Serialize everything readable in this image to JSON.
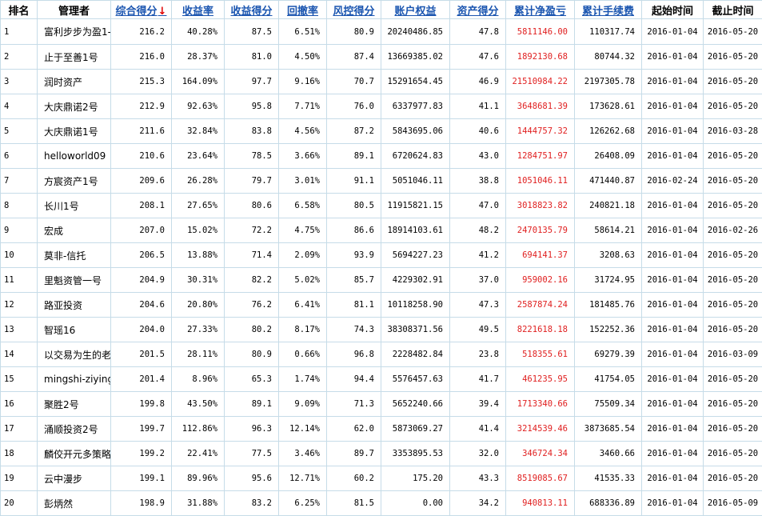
{
  "headers": [
    "排名",
    "管理者",
    "综合得分",
    "收益率",
    "收益得分",
    "回撤率",
    "风控得分",
    "账户权益",
    "资产得分",
    "累计净盈亏",
    "累计手续费",
    "起始时间",
    "截止时间"
  ],
  "sort_arrow": "↓",
  "colors": {
    "border": "#c6dce8",
    "link": "#1a55b0",
    "red": "#e02020"
  },
  "rows": [
    [
      "1",
      "富利步步为盈1-",
      "216.2",
      "40.28%",
      "87.5",
      "6.51%",
      "80.9",
      "20240486.85",
      "47.8",
      "5811146.00",
      "110317.74",
      "2016-01-04",
      "2016-05-20"
    ],
    [
      "2",
      "止于至善1号",
      "216.0",
      "28.37%",
      "81.0",
      "4.50%",
      "87.4",
      "13669385.02",
      "47.6",
      "1892130.68",
      "80744.32",
      "2016-01-04",
      "2016-05-20"
    ],
    [
      "3",
      "润时资产",
      "215.3",
      "164.09%",
      "97.7",
      "9.16%",
      "70.7",
      "15291654.45",
      "46.9",
      "21510984.22",
      "2197305.78",
      "2016-01-04",
      "2016-05-20"
    ],
    [
      "4",
      "大庆鼎诺2号",
      "212.9",
      "92.63%",
      "95.8",
      "7.71%",
      "76.0",
      "6337977.83",
      "41.1",
      "3648681.39",
      "173628.61",
      "2016-01-04",
      "2016-05-20"
    ],
    [
      "5",
      "大庆鼎诺1号",
      "211.6",
      "32.84%",
      "83.8",
      "4.56%",
      "87.2",
      "5843695.06",
      "40.6",
      "1444757.32",
      "126262.68",
      "2016-01-04",
      "2016-03-28"
    ],
    [
      "6",
      "helloworld09",
      "210.6",
      "23.64%",
      "78.5",
      "3.66%",
      "89.1",
      "6720624.83",
      "43.0",
      "1284751.97",
      "26408.09",
      "2016-01-04",
      "2016-05-20"
    ],
    [
      "7",
      "方宸资产1号",
      "209.6",
      "26.28%",
      "79.7",
      "3.01%",
      "91.1",
      "5051046.11",
      "38.8",
      "1051046.11",
      "471440.87",
      "2016-02-24",
      "2016-05-20"
    ],
    [
      "8",
      "长川1号",
      "208.1",
      "27.65%",
      "80.6",
      "6.58%",
      "80.5",
      "11915821.15",
      "47.0",
      "3018823.82",
      "240821.18",
      "2016-01-04",
      "2016-05-20"
    ],
    [
      "9",
      "宏成",
      "207.0",
      "15.02%",
      "72.2",
      "4.75%",
      "86.6",
      "18914103.61",
      "48.2",
      "2470135.79",
      "58614.21",
      "2016-01-04",
      "2016-02-26"
    ],
    [
      "10",
      "莫非-信托",
      "206.5",
      "13.88%",
      "71.4",
      "2.09%",
      "93.9",
      "5694227.23",
      "41.2",
      "694141.37",
      "3208.63",
      "2016-01-04",
      "2016-05-20"
    ],
    [
      "11",
      "里魁资管一号",
      "204.9",
      "30.31%",
      "82.2",
      "5.02%",
      "85.7",
      "4229302.91",
      "37.0",
      "959002.16",
      "31724.95",
      "2016-01-04",
      "2016-05-20"
    ],
    [
      "12",
      "路亚投资",
      "204.6",
      "20.80%",
      "76.2",
      "6.41%",
      "81.1",
      "10118258.90",
      "47.3",
      "2587874.24",
      "181485.76",
      "2016-01-04",
      "2016-05-20"
    ],
    [
      "13",
      "智瑶16",
      "204.0",
      "27.33%",
      "80.2",
      "8.17%",
      "74.3",
      "38308371.56",
      "49.5",
      "8221618.18",
      "152252.36",
      "2016-01-04",
      "2016-05-20"
    ],
    [
      "14",
      "以交易为生的老",
      "201.5",
      "28.11%",
      "80.9",
      "0.66%",
      "96.8",
      "2228482.84",
      "23.8",
      "518355.61",
      "69279.39",
      "2016-01-04",
      "2016-03-09"
    ],
    [
      "15",
      "mingshi-ziying",
      "201.4",
      "8.96%",
      "65.3",
      "1.74%",
      "94.4",
      "5576457.63",
      "41.7",
      "461235.95",
      "41754.05",
      "2016-01-04",
      "2016-05-20"
    ],
    [
      "16",
      "聚胜2号",
      "199.8",
      "43.50%",
      "89.1",
      "9.09%",
      "71.3",
      "5652240.66",
      "39.4",
      "1713340.66",
      "75509.34",
      "2016-01-04",
      "2016-05-20"
    ],
    [
      "17",
      "涌顺投资2号",
      "199.7",
      "112.86%",
      "96.3",
      "12.14%",
      "62.0",
      "5873069.27",
      "41.4",
      "3214539.46",
      "3873685.54",
      "2016-01-04",
      "2016-05-20"
    ],
    [
      "18",
      "麟佼开元多策略",
      "199.2",
      "22.41%",
      "77.5",
      "3.46%",
      "89.7",
      "3353895.53",
      "32.0",
      "346724.34",
      "3460.66",
      "2016-01-04",
      "2016-05-20"
    ],
    [
      "19",
      "云中漫步",
      "199.1",
      "89.96%",
      "95.6",
      "12.71%",
      "60.2",
      "175.20",
      "43.3",
      "8519085.67",
      "41535.33",
      "2016-01-04",
      "2016-05-20"
    ],
    [
      "20",
      "彭炳然",
      "198.9",
      "31.88%",
      "83.2",
      "6.25%",
      "81.5",
      "0.00",
      "34.2",
      "940813.11",
      "688336.89",
      "2016-01-04",
      "2016-05-09"
    ]
  ]
}
